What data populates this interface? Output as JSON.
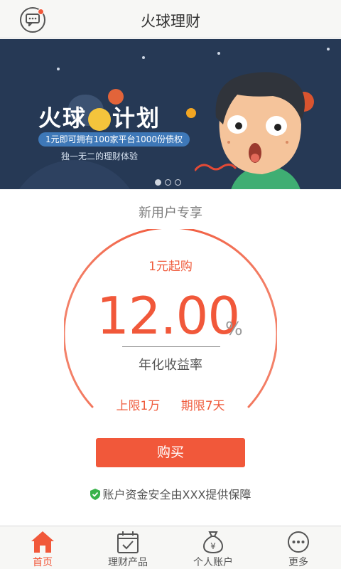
{
  "header": {
    "title": "火球理财",
    "message_icon": "message-icon"
  },
  "banner": {
    "title_left": "火球",
    "title_right": "计划",
    "pill_text": "1元即可拥有100家平台1000份债权",
    "subtitle": "独一无二的理财体验",
    "slide_count": 3,
    "active_slide": 1
  },
  "product": {
    "section_title": "新用户专享",
    "start_text": "1元起购",
    "rate": "12.00",
    "rate_unit": "%",
    "rate_label": "年化收益率",
    "upper_limit": "上限1万",
    "term": "期限7天",
    "buy_label": "购买",
    "security_note": "账户资金安全由XXX提供保障"
  },
  "tabs": [
    {
      "label": "首页",
      "icon": "home-icon",
      "active": true
    },
    {
      "label": "理财产品",
      "icon": "calendar-check-icon",
      "active": false
    },
    {
      "label": "个人账户",
      "icon": "money-bag-icon",
      "active": false
    },
    {
      "label": "更多",
      "icon": "more-icon",
      "active": false
    }
  ],
  "colors": {
    "accent": "#f1583a",
    "banner_bg": "#263955",
    "bar_bg": "#f7f7f5"
  }
}
